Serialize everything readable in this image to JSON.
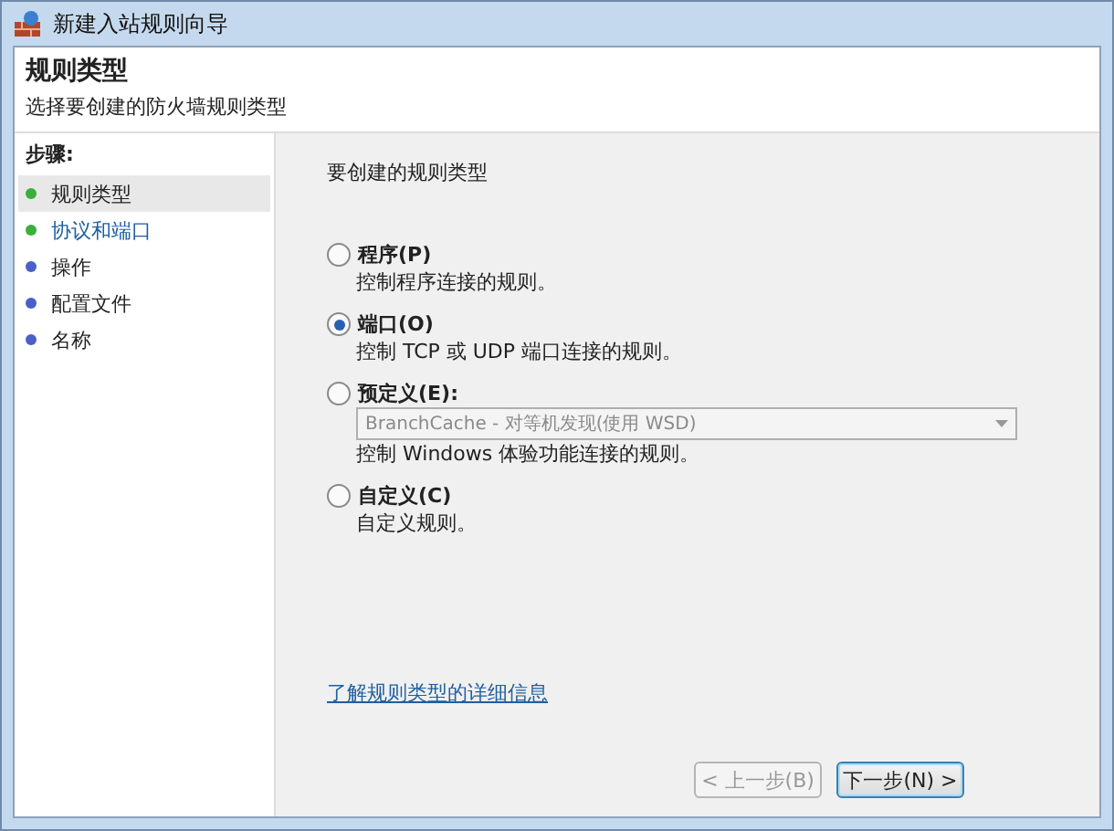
{
  "window": {
    "title": "新建入站规则向导"
  },
  "header": {
    "title": "规则类型",
    "subtitle": "选择要创建的防火墙规则类型"
  },
  "steps": {
    "heading": "步骤:",
    "items": [
      {
        "label": "规则类型",
        "selected": true,
        "color": "#3cae3c"
      },
      {
        "label": "协议和端口",
        "selected": false,
        "color": "#3cae3c"
      },
      {
        "label": "操作",
        "selected": false,
        "color": "#4a5fc8"
      },
      {
        "label": "配置文件",
        "selected": false,
        "color": "#4a5fc8"
      },
      {
        "label": "名称",
        "selected": false,
        "color": "#4a5fc8"
      }
    ]
  },
  "content": {
    "prompt": "要创建的规则类型",
    "options": [
      {
        "label": "程序(P)",
        "description": "控制程序连接的规则。",
        "selected": false
      },
      {
        "label": "端口(O)",
        "description": "控制 TCP 或 UDP 端口连接的规则。",
        "selected": true
      },
      {
        "label": "预定义(E):",
        "dropdown": {
          "value": "BranchCache - 对等机发现(使用 WSD)",
          "disabled": true
        },
        "description": "控制 Windows 体验功能连接的规则。",
        "selected": false
      },
      {
        "label": "自定义(C)",
        "description": "自定义规则。",
        "selected": false
      }
    ],
    "link": "了解规则类型的详细信息"
  },
  "buttons": [
    {
      "label": "< 上一步(B)",
      "disabled": true
    },
    {
      "label": "下一步(N) >",
      "disabled": false
    }
  ]
}
